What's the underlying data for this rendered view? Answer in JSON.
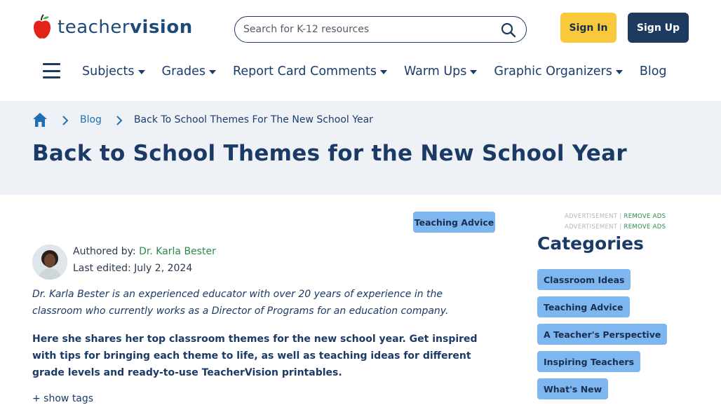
{
  "header": {
    "logo": {
      "word1": "teacher",
      "word2": "vision"
    },
    "search": {
      "placeholder": "Search for K-12 resources",
      "value": "",
      "icon": "search-icon"
    },
    "sign_in": "Sign In",
    "sign_up": "Sign Up"
  },
  "nav": {
    "menu_icon": "hamburger-icon",
    "items": [
      {
        "label": "Subjects",
        "dropdown": true
      },
      {
        "label": "Grades",
        "dropdown": true
      },
      {
        "label": "Report Card Comments",
        "dropdown": true
      },
      {
        "label": "Warm Ups",
        "dropdown": true
      },
      {
        "label": "Graphic Organizers",
        "dropdown": true
      },
      {
        "label": "Blog",
        "dropdown": false
      }
    ]
  },
  "breadcrumb": {
    "home_icon": "home-icon",
    "items": [
      "Blog",
      "Back To School Themes For The New School Year"
    ]
  },
  "page": {
    "title": "Back to School Themes for the New School Year"
  },
  "article": {
    "tag": "Teaching Advice",
    "authored_by_label": "Authored by:",
    "author_name": "Dr. Karla Bester",
    "last_edited": "Last edited: July 2, 2024",
    "bio": "Dr. Karla Bester is an experienced educator with over 20 years of experience in the classroom who currently works as a Director of Programs for an education company.",
    "intro": "Here she shares her top classroom themes for the new school year. Get inspired with tips for bringing each theme to life, as well as teaching ideas for different grade levels and ready-to-use TeacherVision printables.",
    "show_tags": "+ show tags"
  },
  "sidebar": {
    "ad_label": "ADVERTISEMENT",
    "remove_ads": "REMOVE ADS",
    "categories_title": "Categories",
    "categories": [
      "Classroom Ideas",
      "Teaching Advice",
      "A Teacher's Perspective",
      "Inspiring Teachers",
      "What's New"
    ]
  },
  "colors": {
    "brand_navy": "#1e3a5f",
    "sign_in_yellow": "#f9c93b",
    "tag_blue": "#7eb6ef",
    "hero_bg": "#eef2f7",
    "author_green": "#2a8a4a"
  }
}
